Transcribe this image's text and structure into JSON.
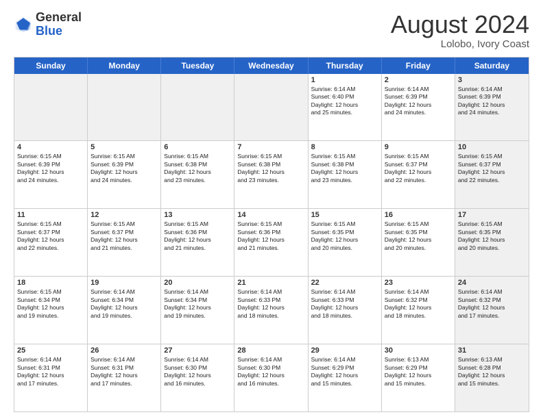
{
  "header": {
    "logo": {
      "line1": "General",
      "line2": "Blue"
    },
    "title": "August 2024",
    "location": "Lolobo, Ivory Coast"
  },
  "days_of_week": [
    "Sunday",
    "Monday",
    "Tuesday",
    "Wednesday",
    "Thursday",
    "Friday",
    "Saturday"
  ],
  "weeks": [
    [
      {
        "day": "",
        "info": "",
        "shaded": true
      },
      {
        "day": "",
        "info": "",
        "shaded": true
      },
      {
        "day": "",
        "info": "",
        "shaded": true
      },
      {
        "day": "",
        "info": "",
        "shaded": true
      },
      {
        "day": "1",
        "info": "Sunrise: 6:14 AM\nSunset: 6:40 PM\nDaylight: 12 hours\nand 25 minutes.",
        "shaded": false
      },
      {
        "day": "2",
        "info": "Sunrise: 6:14 AM\nSunset: 6:39 PM\nDaylight: 12 hours\nand 24 minutes.",
        "shaded": false
      },
      {
        "day": "3",
        "info": "Sunrise: 6:14 AM\nSunset: 6:39 PM\nDaylight: 12 hours\nand 24 minutes.",
        "shaded": true
      }
    ],
    [
      {
        "day": "4",
        "info": "Sunrise: 6:15 AM\nSunset: 6:39 PM\nDaylight: 12 hours\nand 24 minutes.",
        "shaded": false
      },
      {
        "day": "5",
        "info": "Sunrise: 6:15 AM\nSunset: 6:39 PM\nDaylight: 12 hours\nand 24 minutes.",
        "shaded": false
      },
      {
        "day": "6",
        "info": "Sunrise: 6:15 AM\nSunset: 6:38 PM\nDaylight: 12 hours\nand 23 minutes.",
        "shaded": false
      },
      {
        "day": "7",
        "info": "Sunrise: 6:15 AM\nSunset: 6:38 PM\nDaylight: 12 hours\nand 23 minutes.",
        "shaded": false
      },
      {
        "day": "8",
        "info": "Sunrise: 6:15 AM\nSunset: 6:38 PM\nDaylight: 12 hours\nand 23 minutes.",
        "shaded": false
      },
      {
        "day": "9",
        "info": "Sunrise: 6:15 AM\nSunset: 6:37 PM\nDaylight: 12 hours\nand 22 minutes.",
        "shaded": false
      },
      {
        "day": "10",
        "info": "Sunrise: 6:15 AM\nSunset: 6:37 PM\nDaylight: 12 hours\nand 22 minutes.",
        "shaded": true
      }
    ],
    [
      {
        "day": "11",
        "info": "Sunrise: 6:15 AM\nSunset: 6:37 PM\nDaylight: 12 hours\nand 22 minutes.",
        "shaded": false
      },
      {
        "day": "12",
        "info": "Sunrise: 6:15 AM\nSunset: 6:37 PM\nDaylight: 12 hours\nand 21 minutes.",
        "shaded": false
      },
      {
        "day": "13",
        "info": "Sunrise: 6:15 AM\nSunset: 6:36 PM\nDaylight: 12 hours\nand 21 minutes.",
        "shaded": false
      },
      {
        "day": "14",
        "info": "Sunrise: 6:15 AM\nSunset: 6:36 PM\nDaylight: 12 hours\nand 21 minutes.",
        "shaded": false
      },
      {
        "day": "15",
        "info": "Sunrise: 6:15 AM\nSunset: 6:35 PM\nDaylight: 12 hours\nand 20 minutes.",
        "shaded": false
      },
      {
        "day": "16",
        "info": "Sunrise: 6:15 AM\nSunset: 6:35 PM\nDaylight: 12 hours\nand 20 minutes.",
        "shaded": false
      },
      {
        "day": "17",
        "info": "Sunrise: 6:15 AM\nSunset: 6:35 PM\nDaylight: 12 hours\nand 20 minutes.",
        "shaded": true
      }
    ],
    [
      {
        "day": "18",
        "info": "Sunrise: 6:15 AM\nSunset: 6:34 PM\nDaylight: 12 hours\nand 19 minutes.",
        "shaded": false
      },
      {
        "day": "19",
        "info": "Sunrise: 6:14 AM\nSunset: 6:34 PM\nDaylight: 12 hours\nand 19 minutes.",
        "shaded": false
      },
      {
        "day": "20",
        "info": "Sunrise: 6:14 AM\nSunset: 6:34 PM\nDaylight: 12 hours\nand 19 minutes.",
        "shaded": false
      },
      {
        "day": "21",
        "info": "Sunrise: 6:14 AM\nSunset: 6:33 PM\nDaylight: 12 hours\nand 18 minutes.",
        "shaded": false
      },
      {
        "day": "22",
        "info": "Sunrise: 6:14 AM\nSunset: 6:33 PM\nDaylight: 12 hours\nand 18 minutes.",
        "shaded": false
      },
      {
        "day": "23",
        "info": "Sunrise: 6:14 AM\nSunset: 6:32 PM\nDaylight: 12 hours\nand 18 minutes.",
        "shaded": false
      },
      {
        "day": "24",
        "info": "Sunrise: 6:14 AM\nSunset: 6:32 PM\nDaylight: 12 hours\nand 17 minutes.",
        "shaded": true
      }
    ],
    [
      {
        "day": "25",
        "info": "Sunrise: 6:14 AM\nSunset: 6:31 PM\nDaylight: 12 hours\nand 17 minutes.",
        "shaded": false
      },
      {
        "day": "26",
        "info": "Sunrise: 6:14 AM\nSunset: 6:31 PM\nDaylight: 12 hours\nand 17 minutes.",
        "shaded": false
      },
      {
        "day": "27",
        "info": "Sunrise: 6:14 AM\nSunset: 6:30 PM\nDaylight: 12 hours\nand 16 minutes.",
        "shaded": false
      },
      {
        "day": "28",
        "info": "Sunrise: 6:14 AM\nSunset: 6:30 PM\nDaylight: 12 hours\nand 16 minutes.",
        "shaded": false
      },
      {
        "day": "29",
        "info": "Sunrise: 6:14 AM\nSunset: 6:29 PM\nDaylight: 12 hours\nand 15 minutes.",
        "shaded": false
      },
      {
        "day": "30",
        "info": "Sunrise: 6:13 AM\nSunset: 6:29 PM\nDaylight: 12 hours\nand 15 minutes.",
        "shaded": false
      },
      {
        "day": "31",
        "info": "Sunrise: 6:13 AM\nSunset: 6:28 PM\nDaylight: 12 hours\nand 15 minutes.",
        "shaded": true
      }
    ]
  ]
}
